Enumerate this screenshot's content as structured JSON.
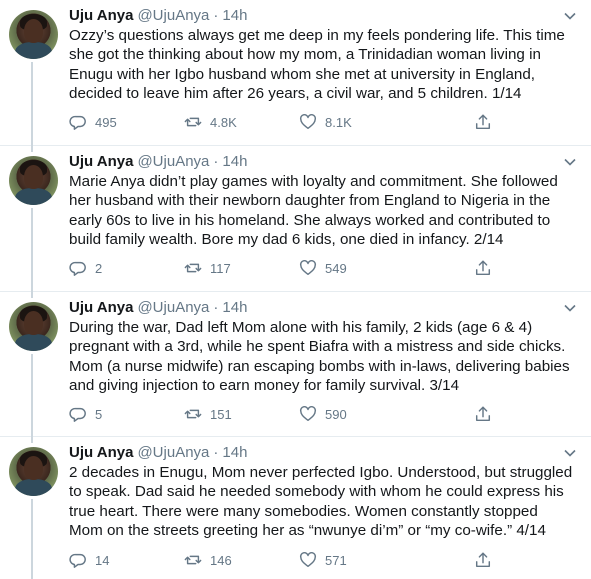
{
  "author": {
    "name": "Uju Anya",
    "handle": "@UjuAnya",
    "time": "14h"
  },
  "tweets": [
    {
      "text": "Ozzy’s questions always get me deep in my feels pondering life. This time she got the thinking about how my mom, a Trinidadian woman living in Enugu with her Igbo husband whom she met at university in England, decided to leave him after 26 years, a civil war, and 5 children. 1/14",
      "replies": "495",
      "retweets": "4.8K",
      "likes": "8.1K"
    },
    {
      "text": "Marie Anya didn’t play games with loyalty and commitment. She followed her husband with their newborn daughter from England to Nigeria in the early 60s to live in his homeland. She always worked and contributed to build family wealth. Bore my dad 6 kids, one died in infancy. 2/14",
      "replies": "2",
      "retweets": "117",
      "likes": "549"
    },
    {
      "text": "During the war, Dad left Mom alone with his family, 2 kids (age 6 & 4) pregnant with a 3rd, while he spent Biafra with a mistress and side chicks. Mom (a nurse midwife) ran escaping bombs with in-laws, delivering babies and giving injection to earn money for family survival. 3/14",
      "replies": "5",
      "retweets": "151",
      "likes": "590"
    },
    {
      "text": "2 decades in Enugu, Mom never perfected Igbo. Understood, but struggled to speak. Dad said he needed somebody with whom he could express his true heart. There were many somebodies. Women constantly stopped Mom on the streets greeting her as “nwunye di’m” or “my co-wife.” 4/14",
      "replies": "14",
      "retweets": "146",
      "likes": "571"
    }
  ],
  "icons": {
    "reply": "reply-icon",
    "retweet": "retweet-icon",
    "like": "heart-icon",
    "share": "share-icon",
    "menu": "chevron-down-icon"
  },
  "colors": {
    "text": "#14171a",
    "muted": "#657786",
    "border": "#e6ecf0",
    "thread": "#ccd6dd"
  }
}
